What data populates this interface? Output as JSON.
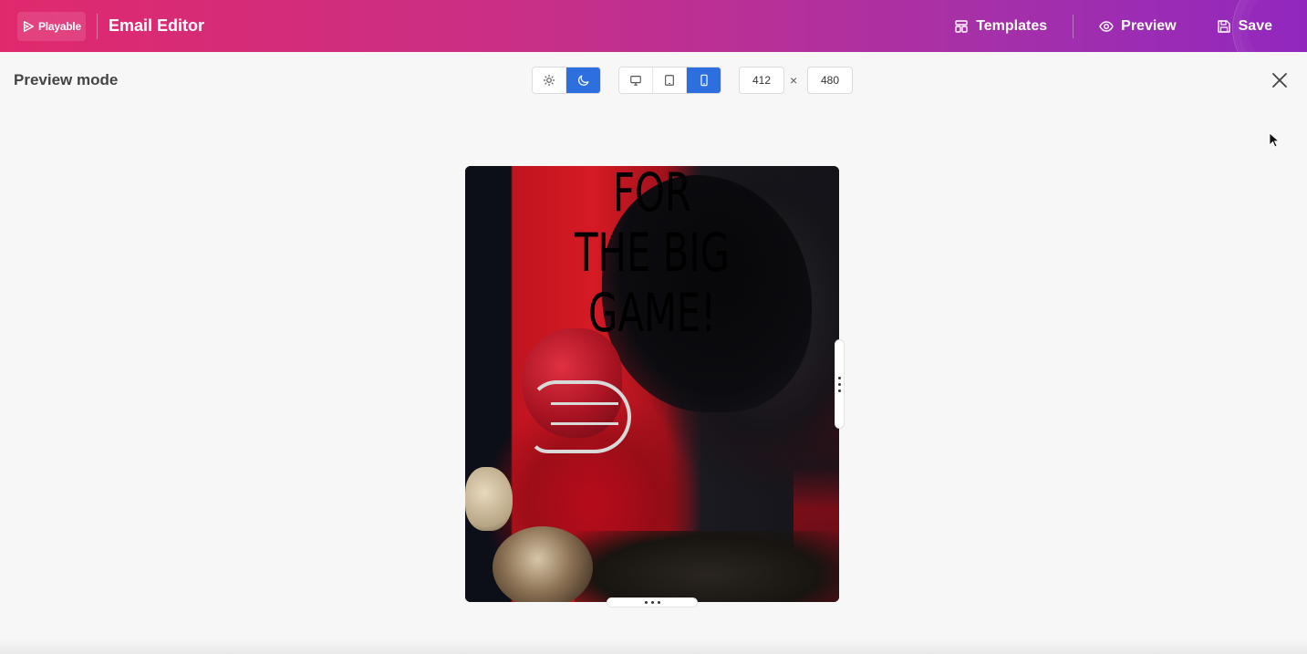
{
  "header": {
    "logo_text": "Playable",
    "title": "Email Editor",
    "actions": [
      {
        "label": "Templates",
        "icon": "templates-icon"
      },
      {
        "label": "Preview",
        "icon": "eye-icon"
      },
      {
        "label": "Save",
        "icon": "save-icon"
      }
    ]
  },
  "preview": {
    "title": "Preview mode",
    "theme_toggle": {
      "options": [
        "light",
        "dark"
      ],
      "selected": "dark"
    },
    "device_toggle": {
      "options": [
        "desktop",
        "tablet",
        "mobile"
      ],
      "selected": "mobile"
    },
    "width": "412",
    "height": "480",
    "separator": "×"
  },
  "email": {
    "headline_line1": "FOR",
    "headline_line2": "THE BIG GAME!"
  },
  "colors": {
    "header_gradient_start": "#e0296d",
    "header_gradient_end": "#9128be",
    "active_toggle": "#2e6fe0"
  }
}
